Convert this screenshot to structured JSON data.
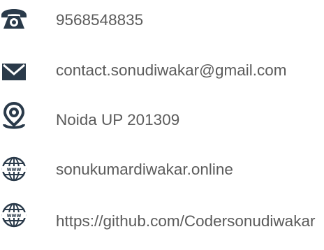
{
  "contact": {
    "phone": "9568548835",
    "email": "contact.sonudiwakar@gmail.com",
    "address": "Noida UP 201309",
    "website": "sonukumardiwakar.online",
    "github": "https://github.com/Codersonudiwakar"
  },
  "icons": {
    "phone": "telephone-icon",
    "email": "envelope-icon",
    "address": "map-pin-icon",
    "website": "globe-www-icon",
    "github": "globe-www-icon"
  },
  "colors": {
    "icon": "#2a3a4a",
    "text": "#5b5b5b"
  }
}
